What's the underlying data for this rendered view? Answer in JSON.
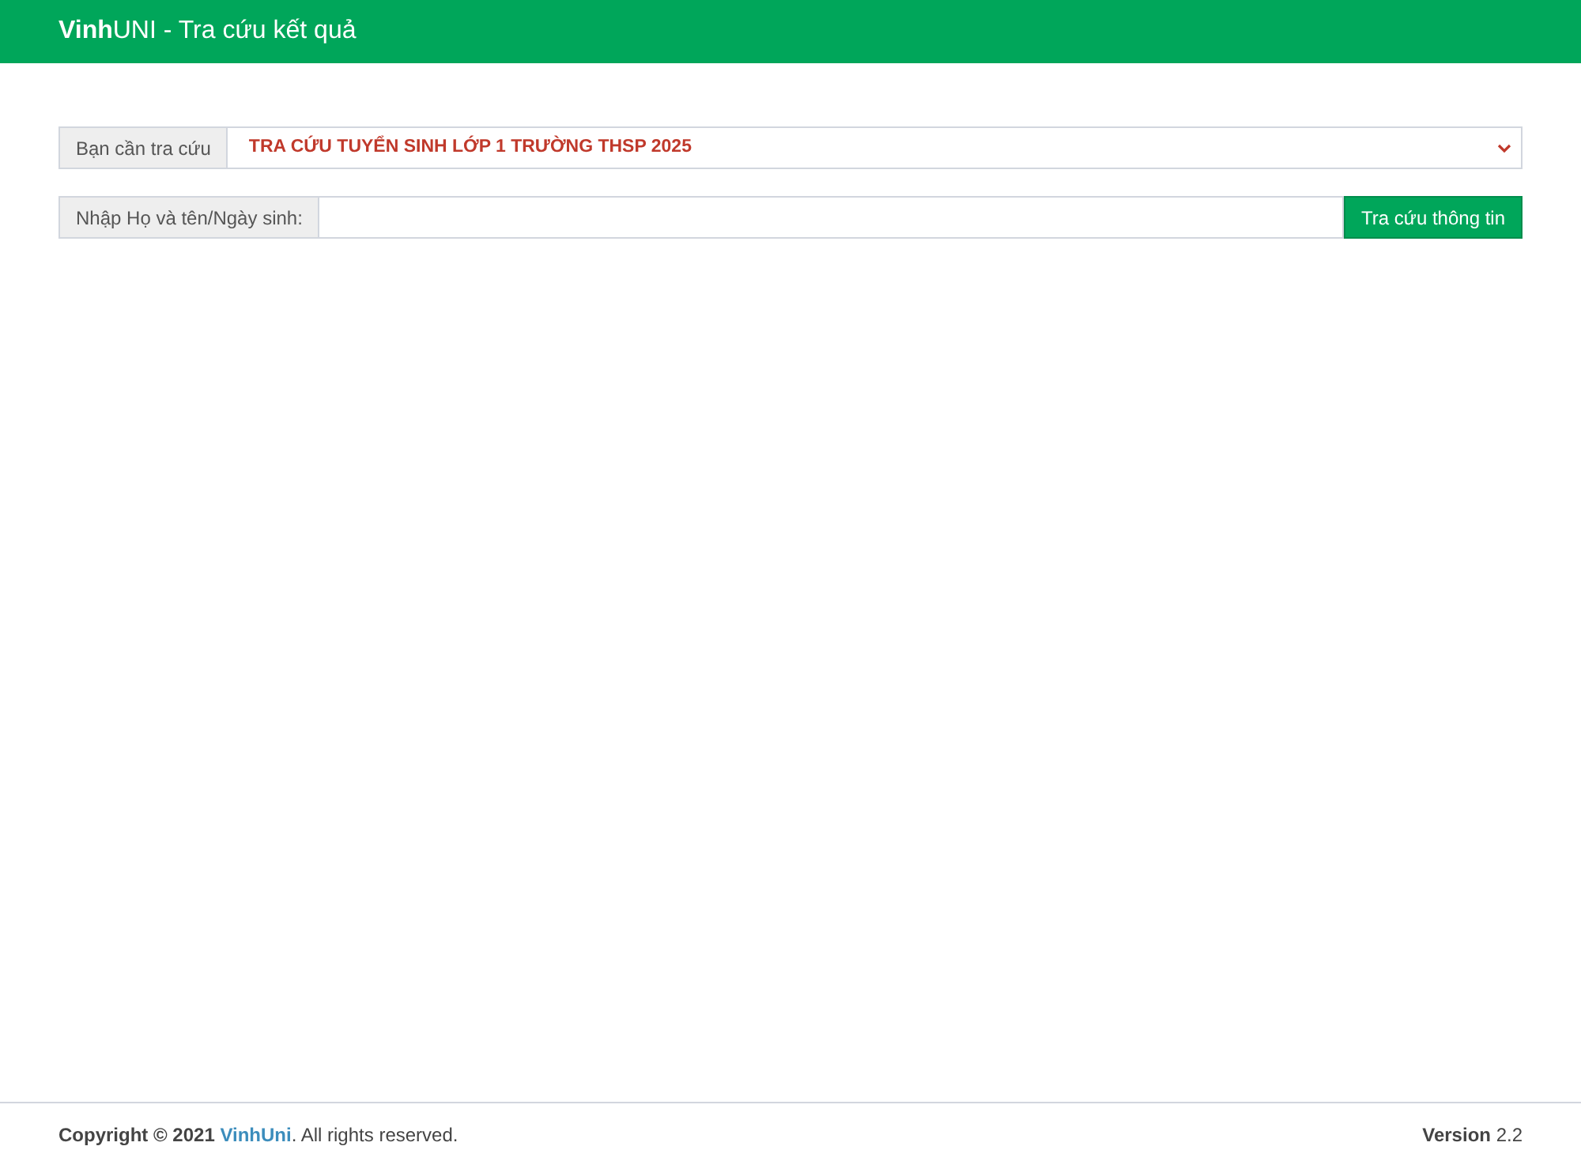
{
  "header": {
    "title": "**Vinh**UNI - Tra cứu kết quả"
  },
  "lookup_select": {
    "label": "Bạn cần tra cứu",
    "value": "TRA CỨU TUYỂN SINH LỚP 1 TRƯỜNG THSP 2025"
  },
  "search": {
    "label": "Nhập Họ và tên/Ngày sinh:",
    "button": "Tra cứu thông tin"
  },
  "footer": {
    "copyright_prefix": "**Copyright © 2021** ",
    "link": "VinhUni",
    "copyright_suffix": ". All rights reserved.",
    "version": "**Version** 2.2"
  }
}
